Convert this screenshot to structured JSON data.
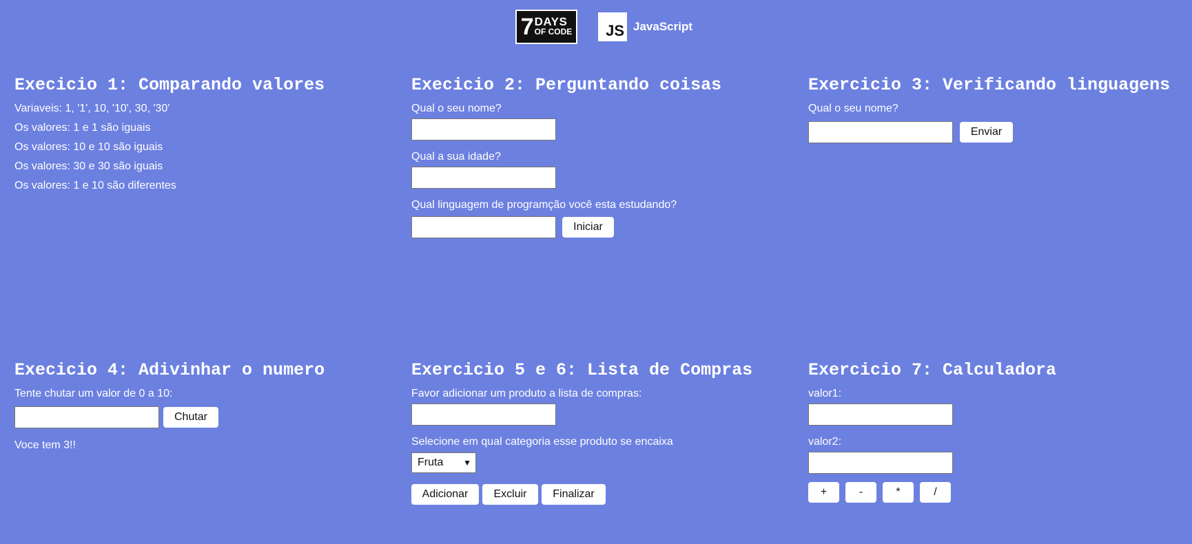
{
  "header": {
    "logo_7days": {
      "seven": "7",
      "line1": "DAYS",
      "line2": "OF CODE"
    },
    "logo_js": {
      "badge": "JS",
      "label": "JavaScript"
    }
  },
  "ex1": {
    "title": "Execicio 1: Comparando valores",
    "lines": [
      "Variaveis: 1, '1', 10, '10', 30, '30'",
      "Os valores: 1 e 1 são iguais",
      "Os valores: 10 e 10 são iguais",
      "Os valores: 30 e 30 são iguais",
      "Os valores: 1 e 10 são diferentes"
    ]
  },
  "ex2": {
    "title": "Execicio 2: Perguntando coisas",
    "label_name": "Qual o seu nome?",
    "name_value": "",
    "label_age": "Qual a sua idade?",
    "age_value": "",
    "label_language": "Qual linguagem de programção você esta estudando?",
    "language_value": "",
    "start_button": "Iniciar"
  },
  "ex3": {
    "title": "Exercicio 3: Verificando linguagens",
    "label_name": "Qual o seu nome?",
    "name_value": "",
    "send_button": "Enviar"
  },
  "ex4": {
    "title": "Execicio 4: Adivinhar o numero",
    "prompt": "Tente chutar um valor de 0 a 10:",
    "guess_value": "",
    "guess_button": "Chutar",
    "attempts": "Voce tem 3!!"
  },
  "ex5": {
    "title": "Exercicio 5 e 6: Lista de Compras",
    "prompt_product": "Favor adicionar um produto a lista de compras:",
    "product_value": "",
    "prompt_category": "Selecione em qual categoria esse produto se encaixa",
    "category_selected": "Fruta",
    "add_button": "Adicionar",
    "delete_button": "Excluir",
    "finish_button": "Finalizar"
  },
  "ex7": {
    "title": "Exercicio 7: Calculadora",
    "label_value1": "valor1:",
    "value1": "",
    "label_value2": "valor2:",
    "value2": "",
    "ops": [
      "+",
      "-",
      "*",
      "/"
    ]
  },
  "colors": {
    "background": "#6c80e0",
    "text": "#ffffff",
    "button_bg": "#ffffff"
  }
}
